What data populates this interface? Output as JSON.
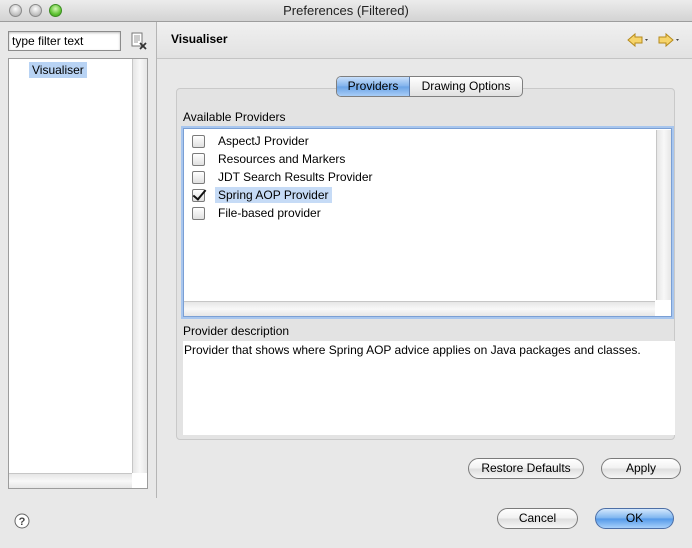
{
  "window": {
    "title": "Preferences (Filtered)"
  },
  "sidebar": {
    "filter_placeholder": "type filter text",
    "filter_value": "type filter text",
    "items": [
      {
        "label": "Visualiser",
        "selected": true
      }
    ]
  },
  "page": {
    "title": "Visualiser",
    "tabs": [
      {
        "label": "Providers",
        "active": true
      },
      {
        "label": "Drawing Options",
        "active": false
      }
    ],
    "available_label": "Available Providers",
    "providers": [
      {
        "label": "AspectJ Provider",
        "checked": false,
        "selected": false
      },
      {
        "label": "Resources and Markers",
        "checked": false,
        "selected": false
      },
      {
        "label": "JDT Search Results Provider",
        "checked": false,
        "selected": false
      },
      {
        "label": "Spring AOP Provider",
        "checked": true,
        "selected": true
      },
      {
        "label": "File-based provider",
        "checked": false,
        "selected": false
      }
    ],
    "description_label": "Provider description",
    "description_text": "Provider that shows where Spring AOP advice applies on Java packages and classes.",
    "restore_defaults_label": "Restore Defaults",
    "apply_label": "Apply"
  },
  "footer": {
    "cancel_label": "Cancel",
    "ok_label": "OK"
  },
  "icons": {
    "help": "help-icon",
    "clear_filter": "clear-filter-icon",
    "back": "back-arrow-icon",
    "forward": "forward-arrow-icon"
  },
  "colors": {
    "selection": "#b8d3f4",
    "default_button": "#5298e8",
    "nav_arrow": "#f0c040"
  }
}
